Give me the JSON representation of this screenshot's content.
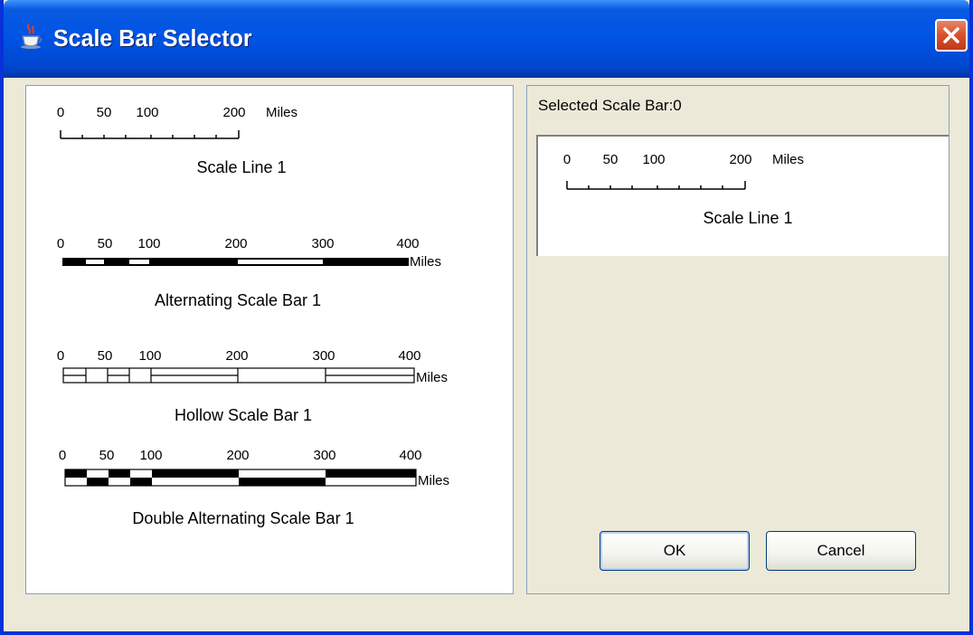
{
  "window": {
    "title": "Scale Bar Selector",
    "icons": {
      "app": "java-cup-icon",
      "close": "close-icon"
    }
  },
  "scale_bars": [
    {
      "name": "Scale Line 1",
      "ticks": [
        "0",
        "50",
        "100",
        "200"
      ],
      "units": "Miles"
    },
    {
      "name": "Alternating Scale Bar 1",
      "ticks": [
        "0",
        "50",
        "100",
        "200",
        "300",
        "400"
      ],
      "units": "Miles"
    },
    {
      "name": "Hollow Scale Bar 1",
      "ticks": [
        "0",
        "50",
        "100",
        "200",
        "300",
        "400"
      ],
      "units": "Miles"
    },
    {
      "name": "Double Alternating Scale Bar 1",
      "ticks": [
        "0",
        "50",
        "100",
        "200",
        "300",
        "400"
      ],
      "units": "Miles"
    }
  ],
  "selection": {
    "label": "Selected Scale Bar:0",
    "preview": {
      "name": "Scale Line 1",
      "ticks": [
        "0",
        "50",
        "100",
        "200"
      ],
      "units": "Miles"
    }
  },
  "buttons": {
    "ok": "OK",
    "cancel": "Cancel"
  },
  "colors": {
    "title_bar": "#0055e5",
    "face": "#ece9d8",
    "close": "#d9502a"
  }
}
